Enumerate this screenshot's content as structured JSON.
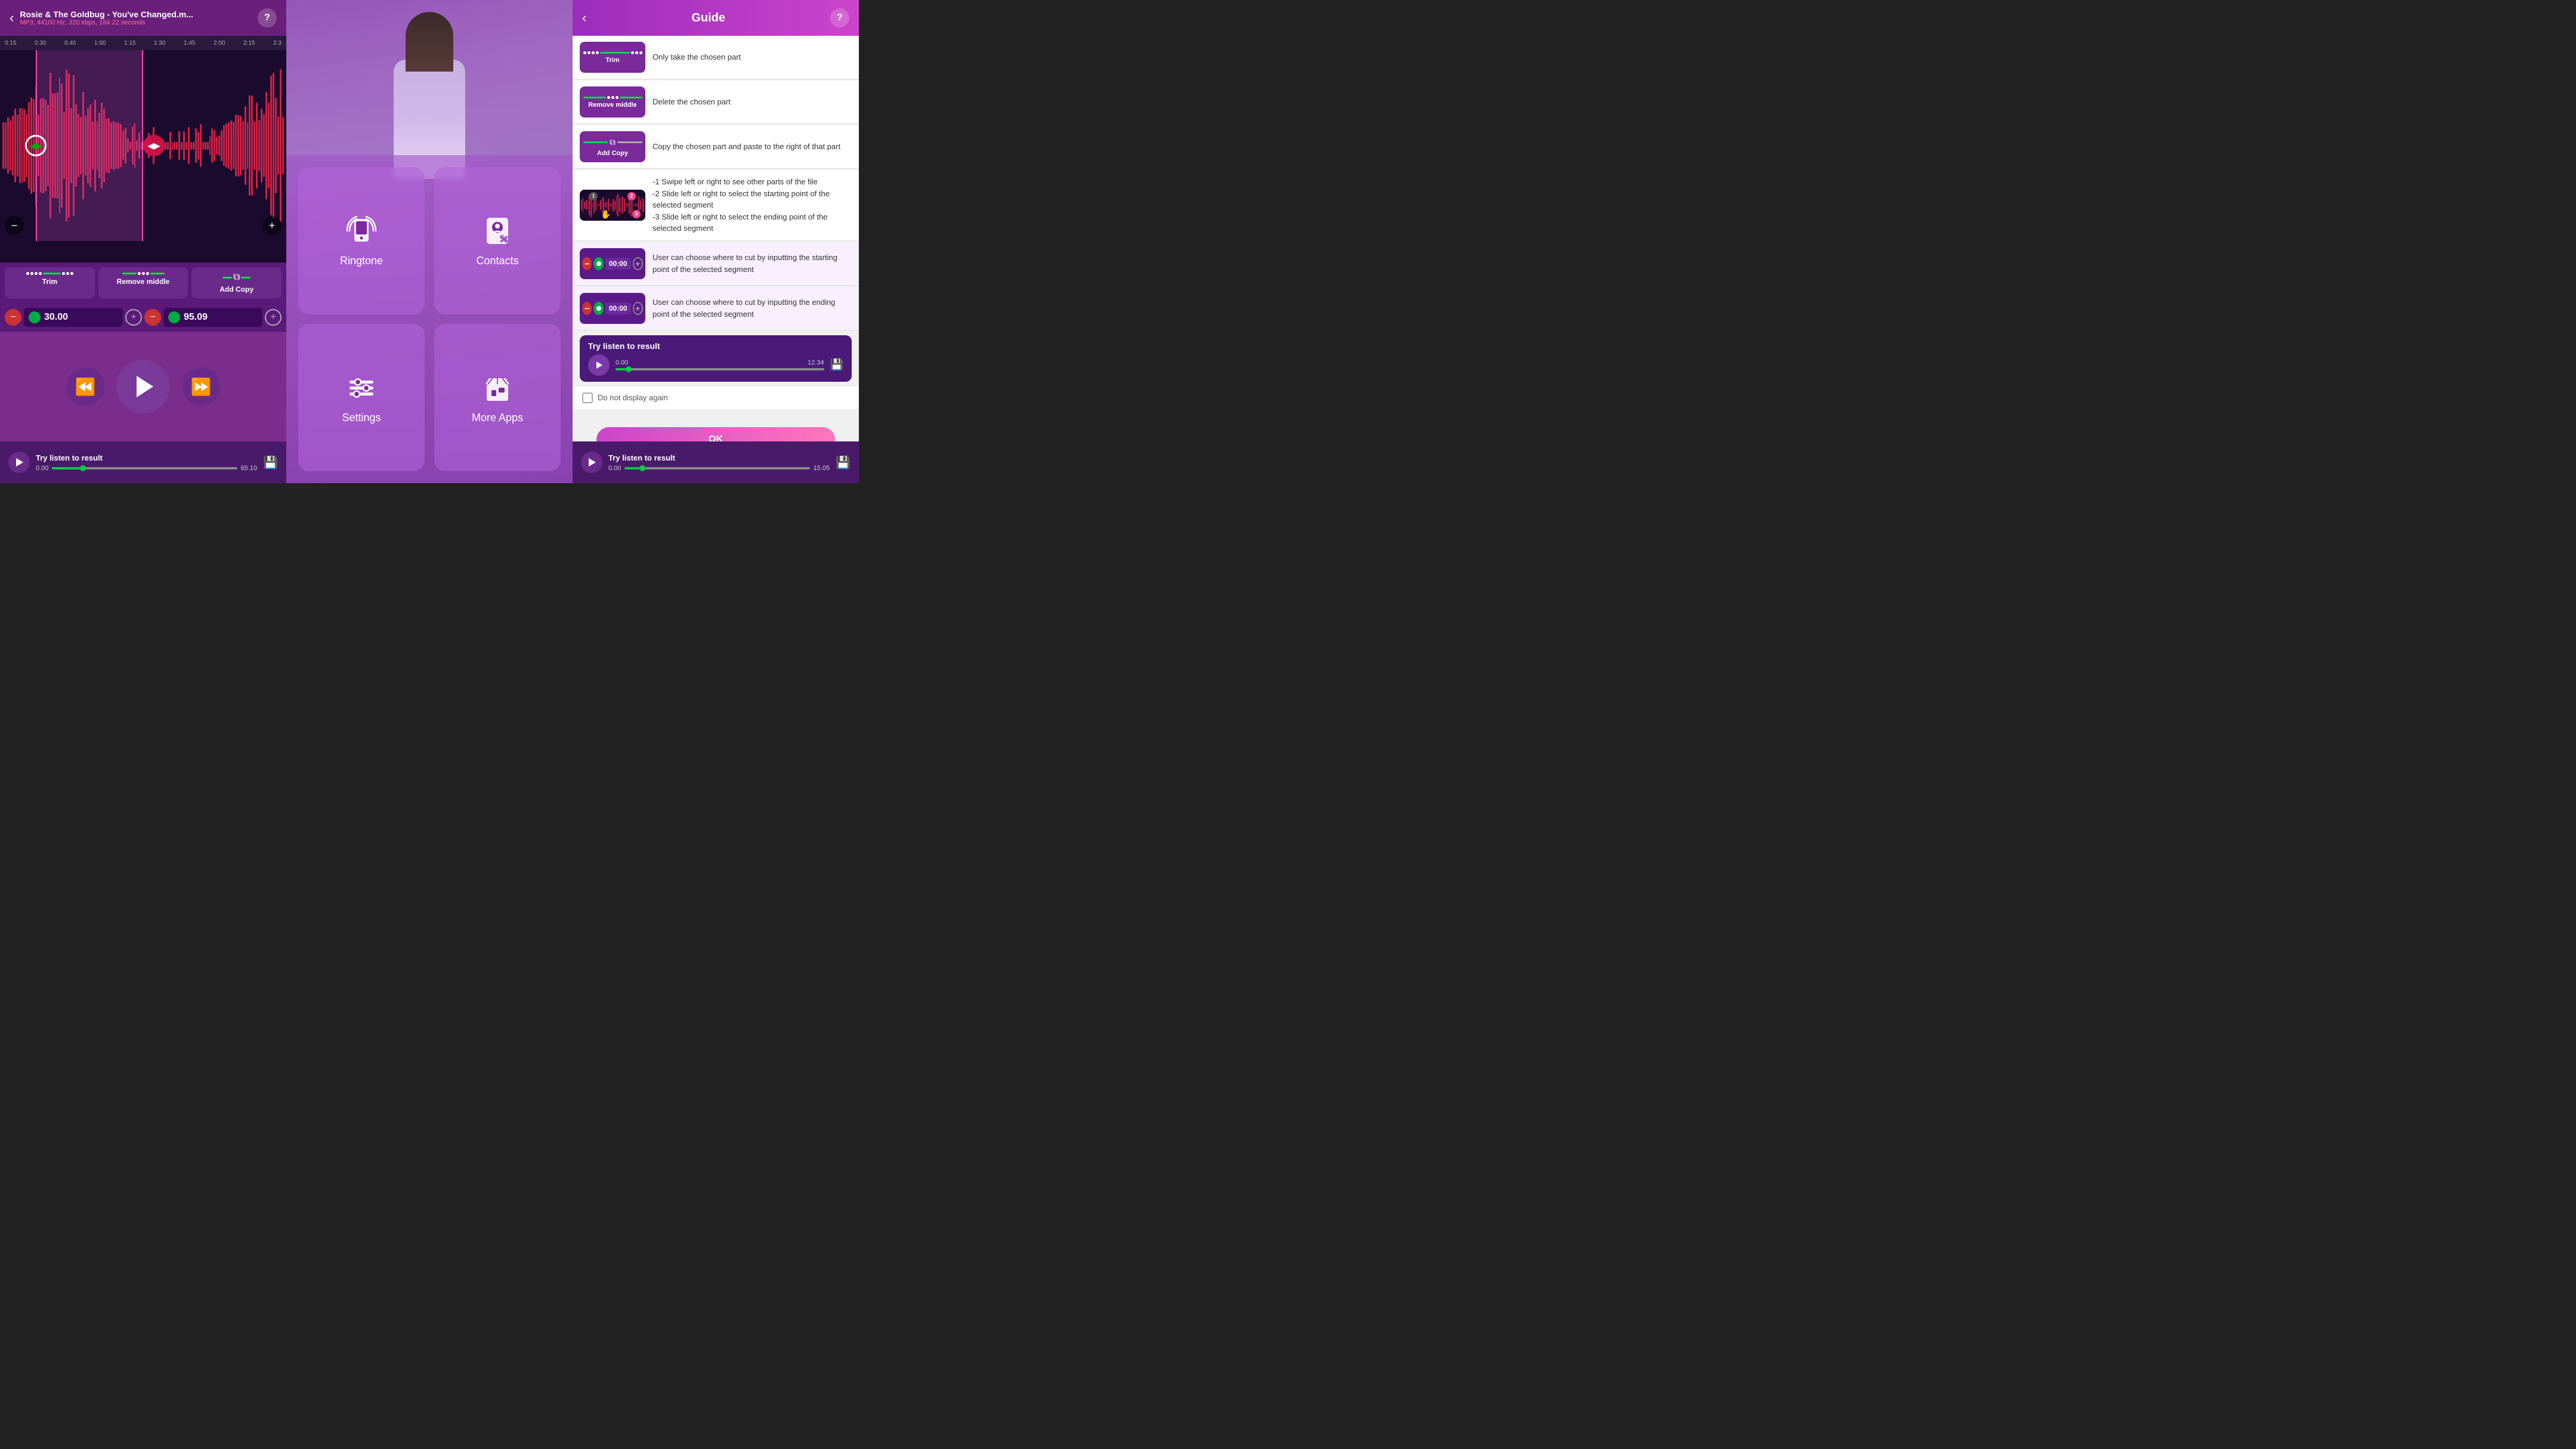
{
  "app": {
    "title": "Rosie & The Goldbug - You've Changed.m...",
    "subtitle": "MP3, 44100 Hz, 320 kbps, 184.22 seconds"
  },
  "panel1": {
    "header": {
      "title": "Rosie & The Goldbug - You've Changed.m...",
      "subtitle": "MP3, 44100 Hz, 320 kbps, 184.22 seconds",
      "back_label": "‹",
      "help_label": "?"
    },
    "timeline_marks": [
      "0:15",
      "0:30",
      "0:45",
      "1:00",
      "1:15",
      "1:30",
      "1:45",
      "2:00",
      "2:15",
      "2:3"
    ],
    "toolbar": {
      "trim_label": "Trim",
      "remove_middle_label": "Remove middle",
      "add_copy_label": "Add Copy"
    },
    "time_start": "30.00",
    "time_end": "95.09",
    "player": {
      "rewind_label": "«",
      "play_label": "▶",
      "fast_forward_label": "»"
    },
    "bottom": {
      "title": "Try listen to result",
      "start_time": "0.00",
      "end_time": "65.10",
      "progress_pct": 15
    }
  },
  "panel2": {
    "menu_items": [
      {
        "id": "ringtone",
        "label": "Ringtone",
        "icon": "phone"
      },
      {
        "id": "contacts",
        "label": "Contacts",
        "icon": "person"
      },
      {
        "id": "settings",
        "label": "Settings",
        "icon": "sliders"
      },
      {
        "id": "more-apps",
        "label": "More Apps",
        "icon": "store"
      }
    ]
  },
  "panel3": {
    "header": {
      "title": "Guide",
      "back_label": "‹",
      "help_label": "?"
    },
    "guide_items": [
      {
        "id": "trim",
        "thumb_type": "trim",
        "label": "Trim",
        "description": "Only take the chosen part"
      },
      {
        "id": "remove-middle",
        "thumb_type": "remove-middle",
        "label": "Remove middle",
        "description": "Delete the chosen part"
      },
      {
        "id": "add-copy",
        "thumb_type": "add-copy",
        "label": "Add Copy",
        "description": "Copy the chosen part and paste to the right of that part"
      },
      {
        "id": "swipe",
        "thumb_type": "waveform",
        "description": "-1 Swipe left or right to see other parts of the file\n-2 Slide left or right to select the starting point of the selected segment\n-3 Slide left or right to select the ending point of the selected segment"
      },
      {
        "id": "start-point",
        "thumb_type": "time-start",
        "time_val": "00:00",
        "description": "User can choose where to cut by inputting the starting point of the selected segment"
      },
      {
        "id": "end-point",
        "thumb_type": "time-end",
        "time_val": "00:00",
        "description": "User can choose where to cut by inputting the ending point of the selected segment"
      }
    ],
    "listen": {
      "title": "Try listen to result",
      "start_time": "0.00",
      "end_time": "12.34",
      "progress_pct": 5
    },
    "do_not_display": "Do not display again",
    "bottom": {
      "title": "Try listen to result",
      "start_time": "0.00",
      "end_time": "15.05",
      "progress_pct": 8
    }
  }
}
